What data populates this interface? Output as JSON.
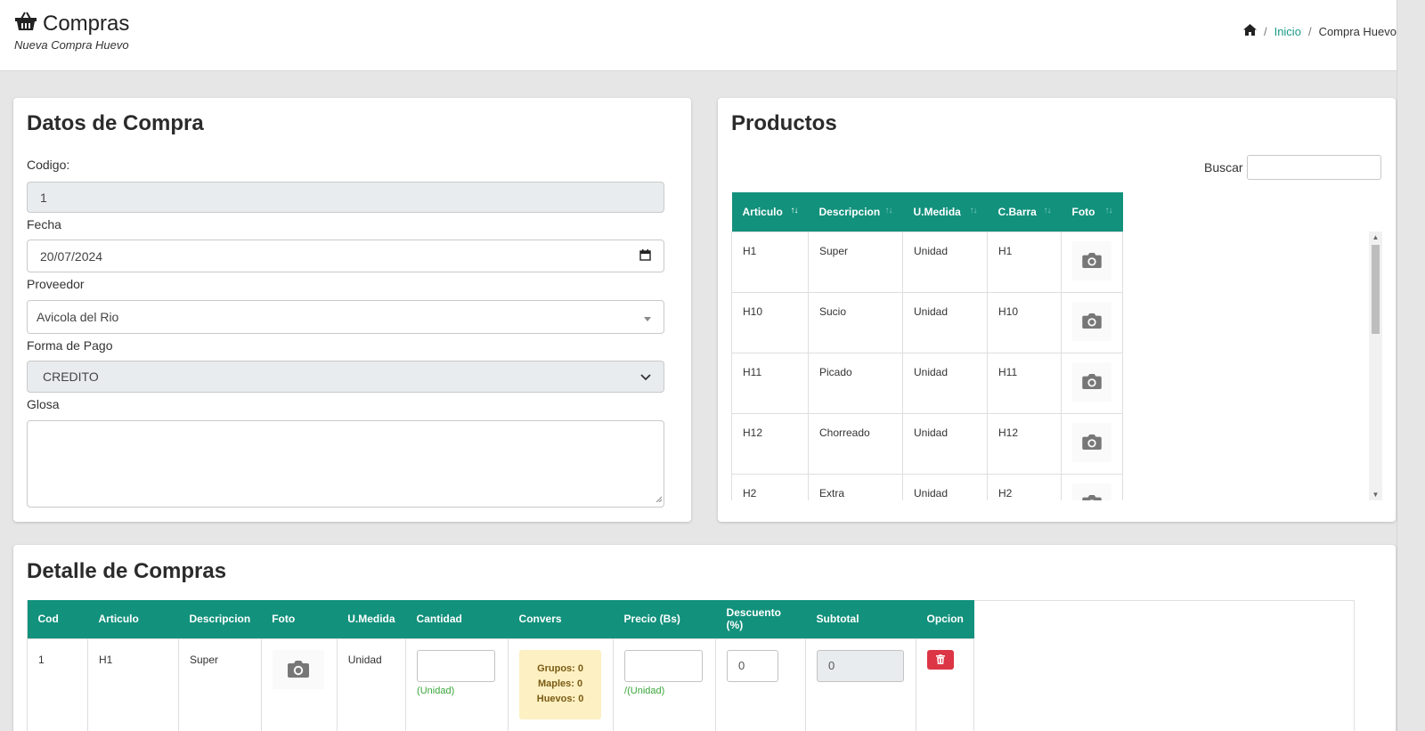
{
  "header": {
    "title": "Compras",
    "subtitle": "Nueva Compra Huevo",
    "breadcrumb": {
      "home": "Inicio",
      "current": "Compra Huevo",
      "separator": "/"
    }
  },
  "datos": {
    "title": "Datos de Compra",
    "codigo": {
      "label": "Codigo:",
      "value": "1"
    },
    "fecha": {
      "label": "Fecha",
      "value": "20/07/2024"
    },
    "proveedor": {
      "label": "Proveedor",
      "value": "Avicola del Rio"
    },
    "forma_pago": {
      "label": "Forma de Pago",
      "value": "CREDITO"
    },
    "glosa": {
      "label": "Glosa",
      "value": ""
    }
  },
  "productos": {
    "title": "Productos",
    "search_label": "Buscar",
    "columns": [
      "Articulo",
      "Descripcion",
      "U.Medida",
      "C.Barra",
      "Foto"
    ],
    "sort_asc": "↑↓",
    "rows": [
      {
        "articulo": "H1",
        "descripcion": "Super",
        "umedida": "Unidad",
        "cbarra": "H1"
      },
      {
        "articulo": "H10",
        "descripcion": "Sucio",
        "umedida": "Unidad",
        "cbarra": "H10"
      },
      {
        "articulo": "H11",
        "descripcion": "Picado",
        "umedida": "Unidad",
        "cbarra": "H11"
      },
      {
        "articulo": "H12",
        "descripcion": "Chorreado",
        "umedida": "Unidad",
        "cbarra": "H12"
      },
      {
        "articulo": "H2",
        "descripcion": "Extra",
        "umedida": "Unidad",
        "cbarra": "H2"
      }
    ]
  },
  "detalle": {
    "title": "Detalle de Compras",
    "columns": [
      "Cod",
      "Articulo",
      "Descripcion",
      "Foto",
      "U.Medida",
      "Cantidad",
      "Convers",
      "Precio (Bs)",
      "Descuento (%)",
      "Subtotal",
      "Opcion"
    ],
    "rows": [
      {
        "cod": "1",
        "articulo": "H1",
        "descripcion": "Super",
        "umedida": "Unidad",
        "cantidad": "",
        "cantidad_hint": "(Unidad)",
        "grupos": "Grupos: 0",
        "maples": "Maples: 0",
        "huevos": "Huevos: 0",
        "precio": "",
        "precio_hint": "/(Unidad)",
        "descuento": "0",
        "subtotal": "0"
      }
    ]
  },
  "colors": {
    "accent": "#12917c",
    "danger": "#dc3545",
    "link": "#1a9a86"
  }
}
